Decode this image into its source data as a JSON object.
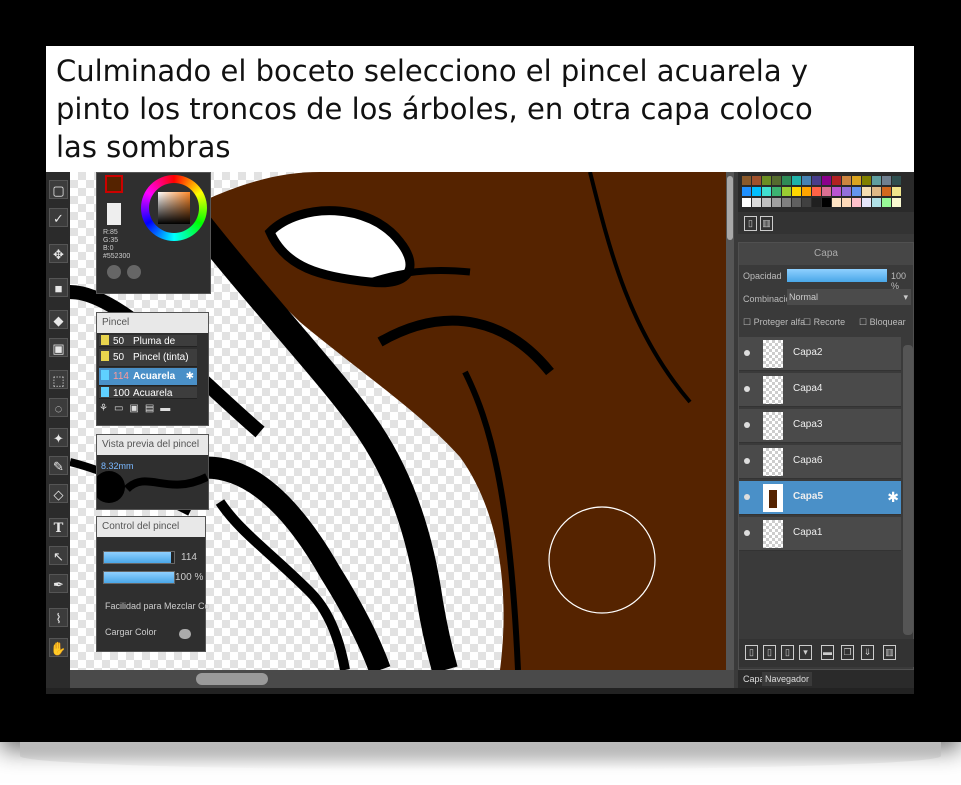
{
  "caption": {
    "line1": "Culminado el boceto selecciono el pincel acuarela y",
    "line2": "pinto los troncos de los árboles, en otra capa coloco",
    "line3": "las sombras"
  },
  "colors": {
    "trunk": "#552300",
    "ink": "#000000",
    "accent": "#4a90c8"
  },
  "color_panel": {
    "r": "R:85",
    "g": "G:35",
    "b": "B:0",
    "hex": "#552300"
  },
  "brush_panel": {
    "title": "Pincel",
    "items": [
      {
        "size": "50",
        "name": "Pluma de punteado"
      },
      {
        "size": "50",
        "name": "Pincel (tinta)"
      },
      {
        "size": "114",
        "name": "Acuarela"
      },
      {
        "size": "100",
        "name": "Acuarela (acuoso)"
      }
    ]
  },
  "preview_panel": {
    "title": "Vista previa del pincel",
    "size": "8.32mm"
  },
  "control_panel": {
    "title": "Control del pincel",
    "size_value": "114",
    "opacity_value": "100 %",
    "size_fraction": 0.96,
    "opacity_fraction": 1.0,
    "mix_label": "Facilidad para Mezclar Co",
    "load_label": "Cargar Color"
  },
  "layer_panel": {
    "title": "Capa",
    "opacity_label": "Opacidad",
    "opacity_value": "100 %",
    "opacity_fraction": 1.0,
    "blend_label": "Combinación",
    "blend_value": "Normal",
    "protect_alpha": "Proteger alfa",
    "clip": "Recorte",
    "lock": "Bloquear",
    "layers": [
      {
        "name": "Capa2",
        "selected": false
      },
      {
        "name": "Capa4",
        "selected": false
      },
      {
        "name": "Capa3",
        "selected": false
      },
      {
        "name": "Capa6",
        "selected": false
      },
      {
        "name": "Capa5",
        "selected": true
      },
      {
        "name": "Capa1",
        "selected": false
      }
    ]
  },
  "bottom_tabs": {
    "layer": "Capa",
    "navigator": "Navegador"
  },
  "tools": [
    "select-icon",
    "lasso-icon",
    "move-icon",
    "rect-icon",
    "fill-icon",
    "gradient-icon",
    "marquee-icon",
    "lasso-select-icon",
    "magic-wand-icon",
    "selection-pen-icon",
    "eraser-select-icon",
    "text-icon",
    "pointer-icon",
    "pen-icon",
    "eyedropper-icon",
    "hand-icon"
  ]
}
